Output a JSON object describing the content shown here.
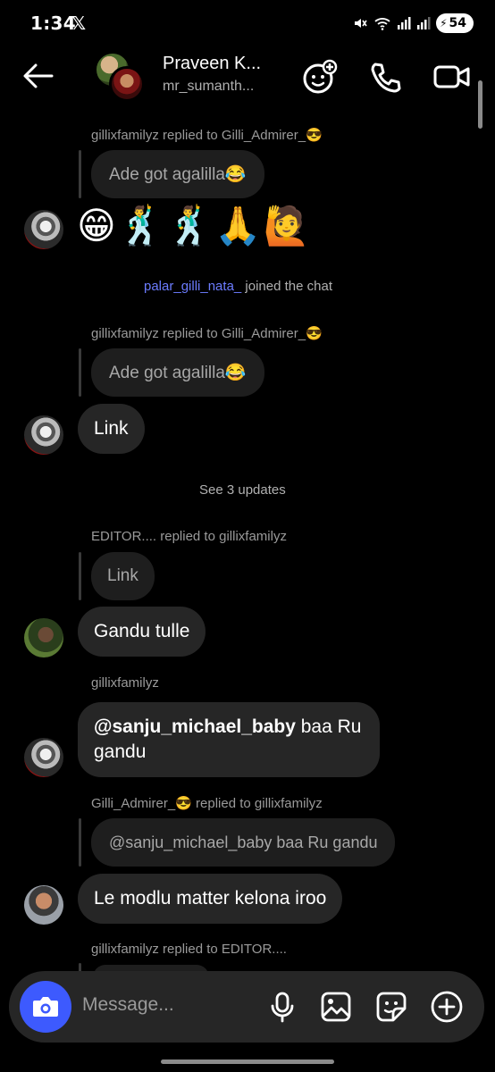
{
  "status_bar": {
    "time": "1:34",
    "x_logo": "𝕏",
    "battery": "54",
    "icons": [
      "mute-icon",
      "wifi-icon",
      "signal-icon",
      "signal-icon",
      "battery-icon"
    ]
  },
  "header": {
    "name": "Praveen K...",
    "username": "mr_sumanth...",
    "buttons": [
      "add-game-icon",
      "phone-icon",
      "video-icon"
    ]
  },
  "messages": {
    "m1": {
      "meta": "gillixfamilyz replied to Gilli_Admirer_😎",
      "reply_text": "Ade got agalilla😂"
    },
    "m2": {
      "emojis": "😁🕺🕺🙏🙋"
    },
    "system1": {
      "user": "palar_gilli_nata_",
      "text": " joined the chat"
    },
    "m3": {
      "meta": "gillixfamilyz replied to Gilli_Admirer_😎",
      "reply_text": "Ade got agalilla😂"
    },
    "m4": {
      "text": "Link"
    },
    "see_updates": "See 3 updates",
    "m5": {
      "meta": "EDITOR.... replied to gillixfamilyz",
      "reply_text": "Link",
      "text": "Gandu tulle"
    },
    "m6": {
      "meta": "gillixfamilyz",
      "mention": "@sanju_michael_baby",
      "text_after": " baa Ru",
      "text_line2": "gandu"
    },
    "m7": {
      "meta": "Gilli_Admirer_😎 replied to gillixfamilyz",
      "reply_text": "@sanju_michael_baby baa Ru gandu",
      "text": "Le modlu matter kelona iroo"
    },
    "m8": {
      "meta": "gillixfamilyz replied to EDITOR...."
    }
  },
  "composer": {
    "placeholder": "Message...",
    "icons": [
      "camera-icon",
      "microphone-icon",
      "gallery-icon",
      "sticker-icon",
      "plus-icon"
    ]
  },
  "colors": {
    "accent": "#3d5afe",
    "system_user": "#6c7cff",
    "bubble": "#262626",
    "reply_bubble": "#1e1e1e"
  }
}
